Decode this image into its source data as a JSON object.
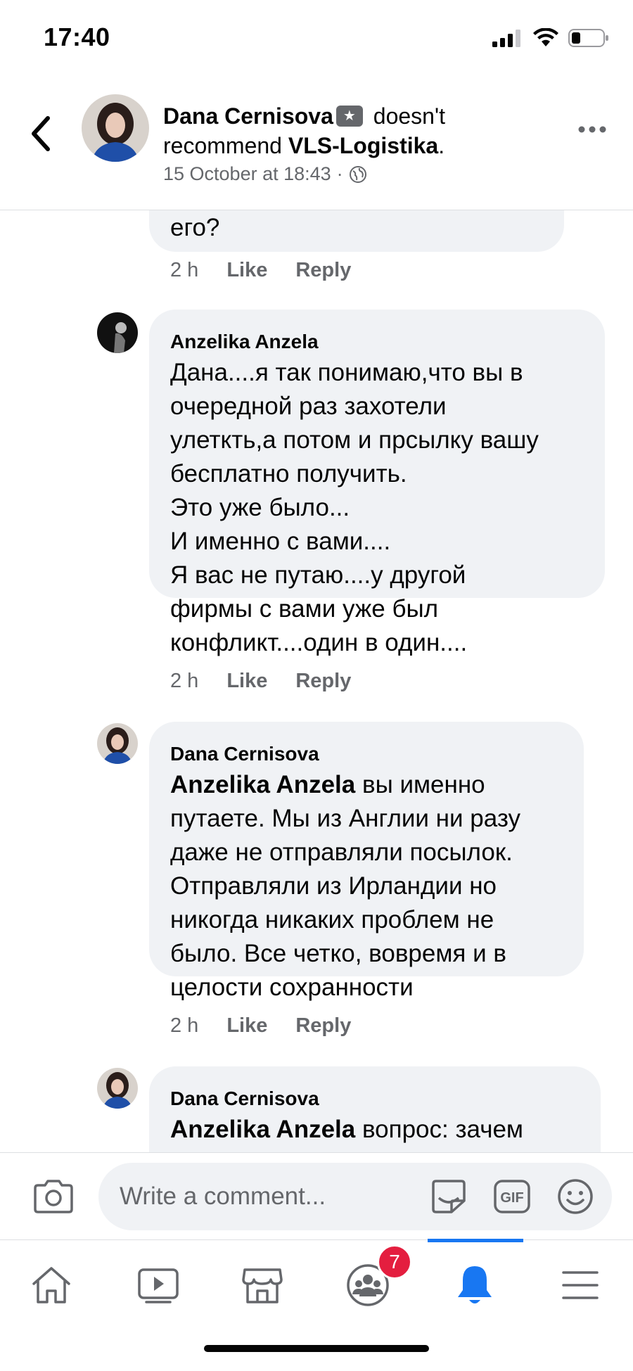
{
  "status_bar": {
    "time": "17:40"
  },
  "header": {
    "author": "Dana Cernisova",
    "verb": "doesn't recommend",
    "page": "VLS-Logistika",
    "period": ".",
    "timestamp": "15 October at 18:43",
    "separator": "·"
  },
  "comments": [
    {
      "partial_text": "его?",
      "time": "2 h",
      "like": "Like",
      "reply": "Reply"
    },
    {
      "author": "Anzelika Anzela",
      "lines": [
        "Дана....я так понимаю,что вы в",
        "очередной раз захотели",
        "улеткть,а потом и прсылку вашу",
        "бесплатно получить.",
        "Это уже было...",
        "И именно с вами....",
        "Я вас не путаю....у другой",
        "фирмы с вами уже был",
        "конфликт....один в один...."
      ],
      "time": "2 h",
      "like": "Like",
      "reply": "Reply"
    },
    {
      "author": "Dana Cernisova",
      "mention": "Anzelika Anzela",
      "first_line_rest": " вы именно",
      "lines": [
        "путаете. Мы из Англии ни разу",
        "даже не отправляли посылок.",
        "Отправляли из Ирландии но",
        "никогда никаких проблем не",
        "было. Все четко, вовремя и в",
        "целости сохранности"
      ],
      "time": "2 h",
      "like": "Like",
      "reply": "Reply"
    },
    {
      "author": "Dana Cernisova",
      "mention": "Anzelika Anzela",
      "first_line_rest": " вопрос: зачем"
    }
  ],
  "composer": {
    "placeholder": "Write a comment..."
  },
  "tabbar": {
    "groups_badge": "7"
  },
  "colors": {
    "accent": "#1877f2",
    "bubble": "#f0f2f5",
    "badge": "#e41e3f"
  }
}
